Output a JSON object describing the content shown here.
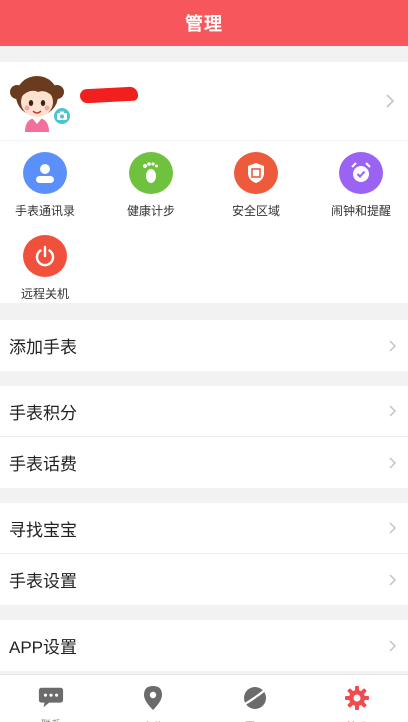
{
  "header": {
    "title": "管理"
  },
  "profile": {
    "name_redacted": true
  },
  "features": [
    {
      "label": "手表通讯录",
      "icon": "contacts-icon",
      "color": "#5b8ff9"
    },
    {
      "label": "健康计步",
      "icon": "footprint-icon",
      "color": "#6fc23d"
    },
    {
      "label": "安全区域",
      "icon": "shield-icon",
      "color": "#ee5a3c"
    },
    {
      "label": "闹钟和提醒",
      "icon": "alarm-clock-icon",
      "color": "#9b63f3"
    },
    {
      "label": "远程关机",
      "icon": "power-icon",
      "color": "#f0503c"
    }
  ],
  "menu": {
    "group1": [
      {
        "label": "添加手表"
      }
    ],
    "group2": [
      {
        "label": "手表积分"
      },
      {
        "label": "手表话费"
      }
    ],
    "group3": [
      {
        "label": "寻找宝宝"
      },
      {
        "label": "手表设置"
      }
    ],
    "group4": [
      {
        "label": "APP设置"
      }
    ]
  },
  "tabbar": [
    {
      "label": "联系",
      "icon": "chat-bubble-icon",
      "active": false
    },
    {
      "label": "定位",
      "icon": "location-pin-icon",
      "active": false
    },
    {
      "label": "圈子",
      "icon": "planet-icon",
      "active": false
    },
    {
      "label": "管理",
      "icon": "gear-icon",
      "active": true
    }
  ],
  "colors": {
    "brand": "#f6565c",
    "active_tab": "#f24a4f"
  }
}
